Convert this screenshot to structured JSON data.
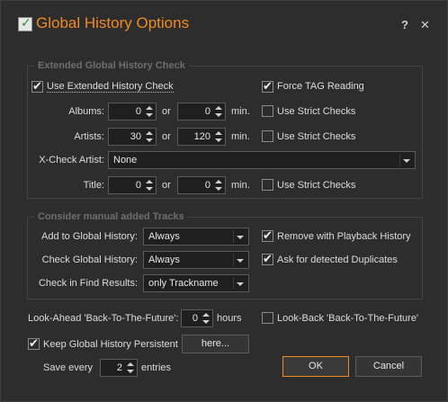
{
  "window": {
    "title": "Global History Options",
    "help_label": "?",
    "close_label": "✕",
    "accent": "#f08a24"
  },
  "extended": {
    "legend": "Extended Global History Check",
    "use_extended": {
      "label": "Use Extended History Check",
      "checked": true
    },
    "force_tag": {
      "label": "Force TAG Reading",
      "checked": true
    },
    "albums": {
      "label": "Albums:",
      "from": "0",
      "or": "or",
      "to": "0",
      "unit": "min.",
      "strict": "Use Strict Checks"
    },
    "artists": {
      "label": "Artists:",
      "from": "30",
      "or": "or",
      "to": "120",
      "unit": "min.",
      "strict": "Use Strict Checks"
    },
    "xcheck": {
      "label": "X-Check Artist:",
      "value": "None"
    },
    "title_row": {
      "label": "Title:",
      "from": "0",
      "or": "or",
      "to": "0",
      "unit": "min.",
      "strict": "Use Strict Checks"
    }
  },
  "manual": {
    "legend": "Consider manual added Tracks",
    "add_global": {
      "label": "Add to Global History:",
      "value": "Always"
    },
    "check_global": {
      "label": "Check Global History:",
      "value": "Always"
    },
    "find_results": {
      "label": "Check in Find Results:",
      "value": "only Trackname"
    },
    "remove_playback": {
      "label": "Remove with Playback History",
      "checked": true
    },
    "ask_duplicates": {
      "label": "Ask for detected Duplicates",
      "checked": true
    }
  },
  "lookahead": {
    "label": "Look-Ahead 'Back-To-The-Future':",
    "value": "0",
    "unit": "hours"
  },
  "lookback": {
    "label": "Look-Back 'Back-To-The-Future'",
    "checked": false
  },
  "persistent": {
    "label": "Keep Global History Persistent",
    "checked": true,
    "button": "here..."
  },
  "save": {
    "label": "Save every",
    "value": "2",
    "unit": "entries"
  },
  "buttons": {
    "ok": "OK",
    "cancel": "Cancel"
  }
}
